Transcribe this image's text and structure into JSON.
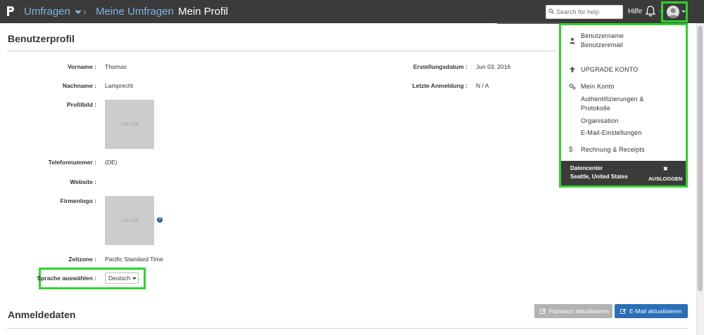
{
  "topbar": {
    "breadcrumb": [
      "Umfragen",
      "Meine Umfragen",
      "Mein Profil"
    ],
    "search_placeholder": "Search for help",
    "help_label": "Hilfe",
    "icons": [
      "logo-p",
      "caret-down-icon",
      "search-icon",
      "bell-icon",
      "avatar-icon"
    ]
  },
  "profile": {
    "section_title": "Benutzerprofil",
    "fields": {
      "firstname_label": "Vorname :",
      "firstname_value": "Thomas",
      "lastname_label": "Nachname :",
      "lastname_value": "Lamprecht",
      "profilepic_label": "Profilbild :",
      "profilepic_placeholder": "100×100",
      "phone_label": "Telefonnummer :",
      "phone_value": "(DE)",
      "website_label": "Website :",
      "companylogo_label": "Firmenlogo :",
      "companylogo_placeholder": "100×100",
      "timezone_label": "Zeitzone :",
      "timezone_value": "Pacific Standard Time",
      "language_label": "Sprache auswählen :",
      "language_value": "Deutsch",
      "created_label": "Erstellungsdatum :",
      "created_value": "Jun 03, 2016",
      "lastlogin_label": "Letzte Anmeldung :",
      "lastlogin_value": "N / A"
    }
  },
  "login": {
    "section_title": "Anmeldedaten",
    "update_password_label": "Passwort aktualisieren",
    "update_email_label": "E-Mail aktualisieren"
  },
  "dropdown": {
    "username": "Benutzername",
    "useremail": "Benutzeremail",
    "upgrade": "UPGRADE KONTO",
    "my_account": "Mein Konto",
    "auth_line1": "Authentifizierungen &",
    "auth_line2": "Protokolle",
    "organisation": "Organisation",
    "email_settings": "E-Mail-Einstellungen",
    "billing": "Rechnung & Receipts",
    "datacenter_line1": "Datencenter",
    "datacenter_line2": "Seattle, United States",
    "logout_x": "✖",
    "logout": "AUSLOGGEN"
  },
  "colors": {
    "topbar": "#3b3b3b",
    "link": "#7fb3e0",
    "highlight": "#2ed32a",
    "primary_button": "#2a6fb7",
    "secondary_button": "#b3b3b3"
  }
}
